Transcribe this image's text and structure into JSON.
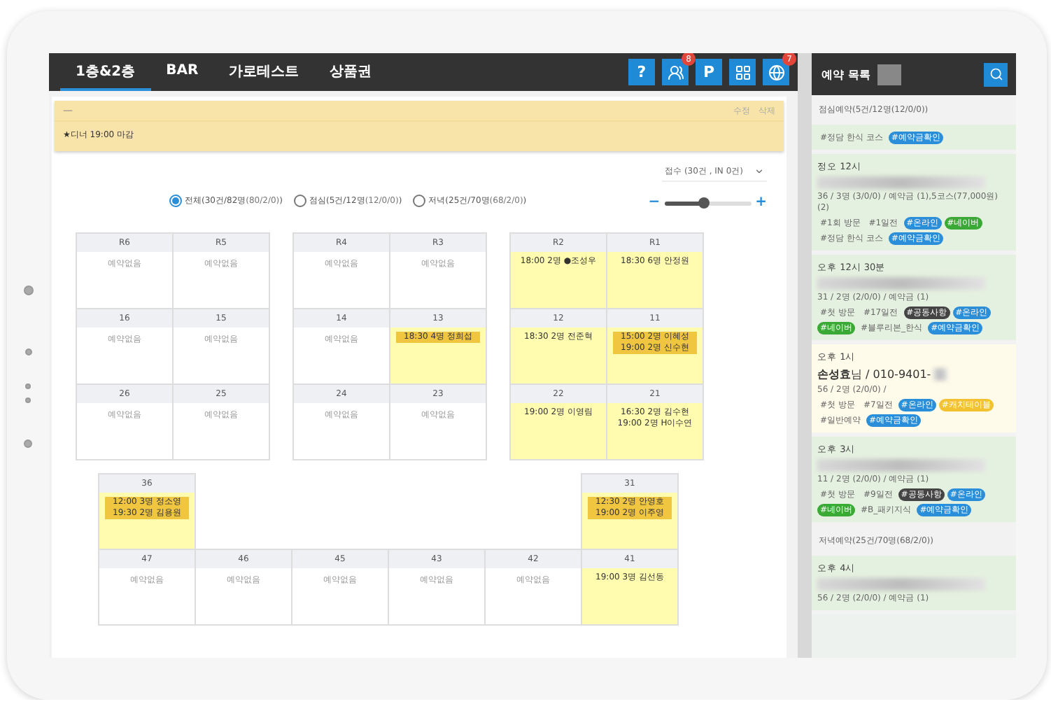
{
  "tabs": [
    {
      "label": "1층&2층",
      "selected": true
    },
    {
      "label": "BAR",
      "selected": false
    },
    {
      "label": "가로테스트",
      "selected": false
    },
    {
      "label": "상품권",
      "selected": false
    }
  ],
  "toolbar_icons": [
    {
      "kind": "help",
      "label": "?"
    },
    {
      "kind": "staff",
      "badge": "8"
    },
    {
      "kind": "parking",
      "label": "P"
    },
    {
      "kind": "grid"
    },
    {
      "kind": "globe",
      "badge": "7"
    }
  ],
  "notice": {
    "title": "—",
    "actions": [
      "수정",
      "삭제"
    ],
    "text": "★디너 19:00 마감"
  },
  "filters": [
    {
      "label": "전체(30건/82명",
      "detail": "(80/2/0)",
      "close": ")",
      "selected": true
    },
    {
      "label": "점심(5건/12명",
      "detail": "(12/0/0)",
      "close": ")",
      "selected": false
    },
    {
      "label": "저녁(25건/70명",
      "detail": "(68/2/0)",
      "close": ")",
      "selected": false
    }
  ],
  "sort_dropdown": {
    "value": "접수 (30건 , IN 0건)"
  },
  "zoom": {
    "level": 0.45,
    "minus": "−",
    "plus": "+"
  },
  "floor_upper": [
    [
      [
        {
          "number": "R6",
          "kind": "empty",
          "note": "예약없음"
        },
        {
          "number": "R5",
          "kind": "empty",
          "note": "예약없음"
        }
      ],
      [
        {
          "number": "R4",
          "kind": "empty",
          "note": "예약없음"
        },
        {
          "number": "R3",
          "kind": "empty",
          "note": "예약없음"
        }
      ],
      [
        {
          "number": "R2",
          "kind": "booked",
          "reservations": [
            {
              "text": "18:00 2명 ●조성우",
              "highlighted": false
            }
          ]
        },
        {
          "number": "R1",
          "kind": "booked",
          "reservations": [
            {
              "text": "18:30 6명 안정원",
              "highlighted": false
            }
          ]
        }
      ]
    ],
    [
      [
        {
          "number": "16",
          "kind": "empty",
          "note": "예약없음"
        },
        {
          "number": "15",
          "kind": "empty",
          "note": "예약없음"
        }
      ],
      [
        {
          "number": "14",
          "kind": "empty",
          "note": "예약없음"
        },
        {
          "number": "13",
          "kind": "booked",
          "reservations": [
            {
              "text": "18:30 4명 정희섭",
              "highlighted": true
            }
          ]
        }
      ],
      [
        {
          "number": "12",
          "kind": "booked",
          "reservations": [
            {
              "text": "18:30 2명 전준혁",
              "highlighted": false
            }
          ]
        },
        {
          "number": "11",
          "kind": "booked",
          "reservations": [
            {
              "text": "15:00 2명 이혜성",
              "highlighted": true
            },
            {
              "text": "19:00 2명 신수현",
              "highlighted": true
            }
          ]
        }
      ]
    ],
    [
      [
        {
          "number": "26",
          "kind": "empty",
          "note": "예약없음"
        },
        {
          "number": "25",
          "kind": "empty",
          "note": "예약없음"
        }
      ],
      [
        {
          "number": "24",
          "kind": "empty",
          "note": "예약없음"
        },
        {
          "number": "23",
          "kind": "empty",
          "note": "예약없음"
        }
      ],
      [
        {
          "number": "22",
          "kind": "booked",
          "reservations": [
            {
              "text": "19:00 2명 이영림",
              "highlighted": false
            }
          ]
        },
        {
          "number": "21",
          "kind": "booked",
          "reservations": [
            {
              "text": "16:30 2명 김수현",
              "highlighted": false
            },
            {
              "text": "19:00 2명 H이수연",
              "highlighted": false
            }
          ]
        }
      ]
    ]
  ],
  "floor_lower": [
    [
      {
        "number": "36",
        "kind": "booked",
        "reservations": [
          {
            "text": "12:00 3명 정소영",
            "highlighted": true
          },
          {
            "text": "19:30 2명 김용원",
            "highlighted": true
          }
        ]
      },
      {
        "kind": "gap"
      },
      {
        "kind": "gap"
      },
      {
        "kind": "gap"
      },
      {
        "kind": "gap"
      },
      {
        "number": "31",
        "kind": "booked",
        "reservations": [
          {
            "text": "12:30 2명 안영호",
            "highlighted": true
          },
          {
            "text": "19:00 2명 이주영",
            "highlighted": true
          }
        ]
      }
    ],
    [
      {
        "number": "47",
        "kind": "empty",
        "note": "예약없음"
      },
      {
        "number": "46",
        "kind": "empty",
        "note": "예약없음"
      },
      {
        "number": "45",
        "kind": "empty",
        "note": "예약없음"
      },
      {
        "number": "43",
        "kind": "empty",
        "note": "예약없음"
      },
      {
        "number": "42",
        "kind": "empty",
        "note": "예약없음"
      },
      {
        "number": "41",
        "kind": "booked",
        "reservations": [
          {
            "text": "19:00 3명 김선동",
            "highlighted": false
          }
        ]
      }
    ]
  ],
  "sidebar": {
    "title": "예약 목록",
    "sections": [
      {
        "title": "점심예약(5건/12명(12/0/0))",
        "cards": [
          {
            "selected": false,
            "tags": [
              {
                "text": "#정담 한식 코스",
                "kind": "plain"
              },
              {
                "text": "#예약금확인",
                "kind": "pill",
                "color": "#2b8ed8"
              }
            ]
          },
          {
            "selected": false,
            "time": "정오 12시",
            "masked": true,
            "info": "36 / 3명 (3/0/0) / 예약금 (1),5코스(77,000원) (2)",
            "tags": [
              {
                "text": "#1회 방문",
                "kind": "plain"
              },
              {
                "text": "#1일전",
                "kind": "plain"
              },
              {
                "text": "#온라인",
                "kind": "pill",
                "color": "#2b8ed8"
              },
              {
                "text": "#네이버",
                "kind": "pill",
                "color": "#3aa935"
              },
              {
                "text": "#정담 한식 코스",
                "kind": "plain"
              },
              {
                "text": "#예약금확인",
                "kind": "pill",
                "color": "#2b8ed8"
              }
            ]
          },
          {
            "selected": false,
            "time": "오후 12시 30분",
            "masked": true,
            "info": "31 / 2명 (2/0/0) / 예약금 (1)",
            "tags": [
              {
                "text": "#첫 방문",
                "kind": "plain"
              },
              {
                "text": "#17일전",
                "kind": "plain"
              },
              {
                "text": "#공동사항",
                "kind": "pill",
                "color": "#444444"
              },
              {
                "text": "#온라인",
                "kind": "pill",
                "color": "#2b8ed8"
              },
              {
                "text": "#네이버",
                "kind": "pill",
                "color": "#3aa935"
              },
              {
                "text": "#블루리본_한식",
                "kind": "plain"
              },
              {
                "text": "#예약금확인",
                "kind": "pill",
                "color": "#2b8ed8"
              }
            ]
          },
          {
            "selected": true,
            "time": "오후 1시",
            "name": "**손성효**님 / 010-9401-",
            "masked": true,
            "info": "56 / 2명 (2/0/0) /",
            "tags": [
              {
                "text": "#첫 방문",
                "kind": "plain"
              },
              {
                "text": "#7일전",
                "kind": "plain"
              },
              {
                "text": "#온라인",
                "kind": "pill",
                "color": "#2b8ed8"
              },
              {
                "text": "#캐치테이블",
                "kind": "pill",
                "color": "#f2c230"
              },
              {
                "text": "#일반예약",
                "kind": "plain"
              },
              {
                "text": "#예약금확인",
                "kind": "pill",
                "color": "#2b8ed8"
              }
            ]
          },
          {
            "selected": false,
            "time": "오후 3시",
            "masked": true,
            "info": "11 / 2명 (2/0/0) / 예약금 (1)",
            "tags": [
              {
                "text": "#첫 방문",
                "kind": "plain"
              },
              {
                "text": "#9일전",
                "kind": "plain"
              },
              {
                "text": "#공동사항",
                "kind": "pill",
                "color": "#444444"
              },
              {
                "text": "#온라인",
                "kind": "pill",
                "color": "#2b8ed8"
              },
              {
                "text": "#네이버",
                "kind": "pill",
                "color": "#3aa935"
              },
              {
                "text": "#B_패키지식",
                "kind": "plain"
              },
              {
                "text": "#예약금확인",
                "kind": "pill",
                "color": "#2b8ed8"
              }
            ]
          }
        ]
      },
      {
        "title": "저녁예약(25건/70명(68/2/0))",
        "cards": [
          {
            "selected": false,
            "time": "오후 4시",
            "masked": true,
            "info": "56 / 2명 (2/0/0) / 예약금 (1)"
          }
        ]
      }
    ]
  }
}
